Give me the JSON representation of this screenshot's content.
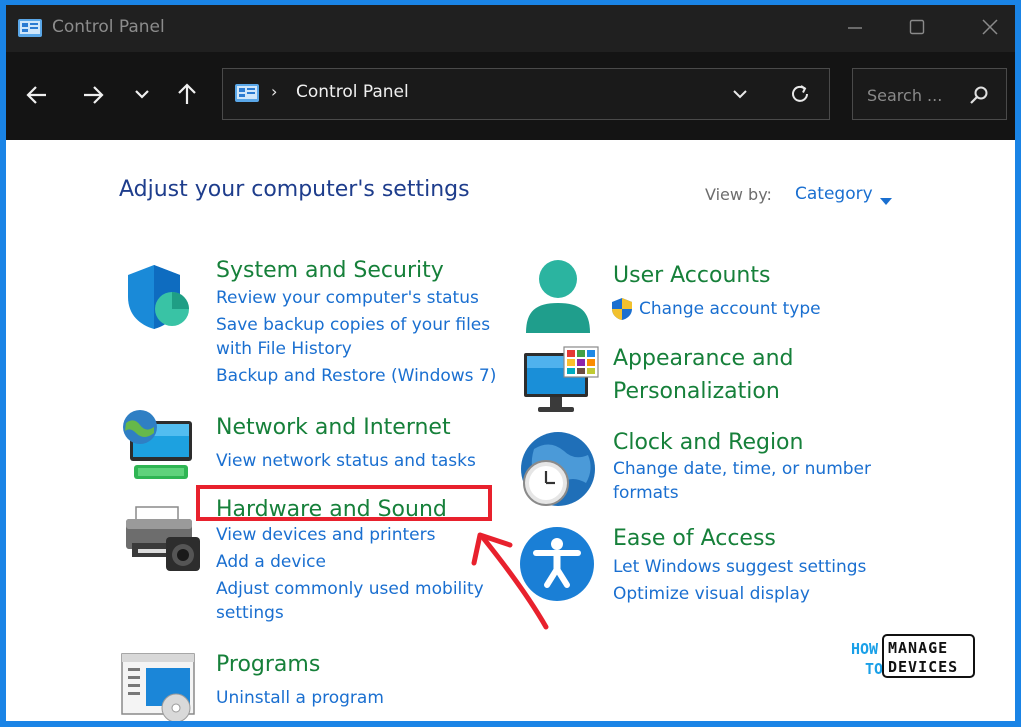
{
  "window": {
    "title": "Control Panel"
  },
  "address": {
    "breadcrumb": "Control Panel",
    "separator": "›"
  },
  "search": {
    "placeholder": "Search ..."
  },
  "heading": "Adjust your computer's settings",
  "view_by": {
    "label": "View by:",
    "value": "Category"
  },
  "categories": [
    {
      "title": "System and Security",
      "links": [
        "Review your computer's status",
        "Save backup copies of your files",
        "with File History",
        "Backup and Restore (Windows 7)"
      ]
    },
    {
      "title": "Network and Internet",
      "links": [
        "View network status and tasks"
      ]
    },
    {
      "title": "Hardware and Sound",
      "links": [
        "View devices and printers",
        "Add a device",
        "Adjust commonly used mobility",
        "settings"
      ]
    },
    {
      "title": "Programs",
      "links": [
        "Uninstall a program"
      ]
    },
    {
      "title": "User Accounts",
      "links": [
        "Change account type"
      ]
    },
    {
      "title_lines": [
        "Appearance and",
        "Personalization"
      ]
    },
    {
      "title": "Clock and Region",
      "links": [
        "Change date, time, or number",
        "formats"
      ]
    },
    {
      "title": "Ease of Access",
      "links": [
        "Let Windows suggest settings",
        "Optimize visual display"
      ]
    }
  ],
  "logo": {
    "line1": "HOW",
    "line2": "TO",
    "word1": "MANAGE",
    "word2": "DEVICES"
  },
  "colors": {
    "category_title": "#16803a",
    "link": "#1a6fd0",
    "heading": "#1e3d8c",
    "highlight": "#e8212d",
    "frame": "#1a84e6"
  },
  "icons": [
    "control-panel-icon",
    "minimize-icon",
    "maximize-icon",
    "close-icon",
    "back-arrow-icon",
    "forward-arrow-icon",
    "recent-dropdown-icon",
    "up-arrow-icon",
    "refresh-icon",
    "search-icon",
    "shield-icon",
    "network-icon",
    "printer-icon",
    "programs-icon",
    "user-icon",
    "uac-shield-icon",
    "monitor-icon",
    "clock-globe-icon",
    "accessibility-icon"
  ]
}
